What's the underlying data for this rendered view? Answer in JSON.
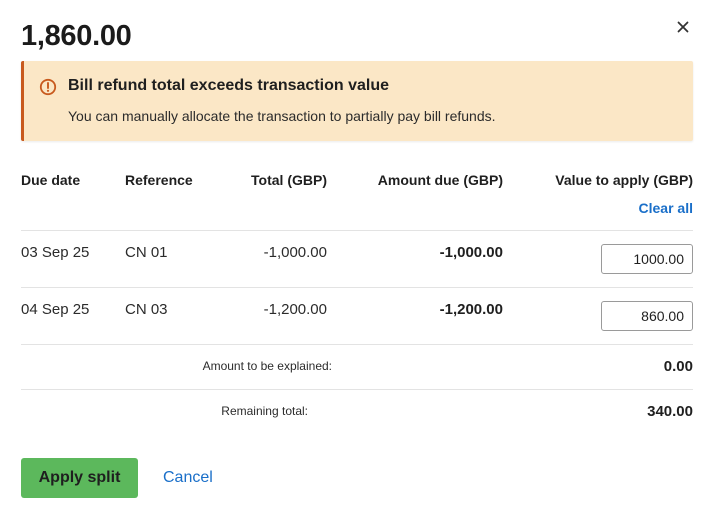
{
  "header": {
    "title": "1,860.00",
    "close_icon": "close-icon"
  },
  "alert": {
    "icon": "warning-circle-icon",
    "title": "Bill refund total exceeds transaction value",
    "body": "You can manually allocate the transaction to partially pay bill refunds.",
    "background": "#fbe7c6",
    "accent": "#c85a1e"
  },
  "table": {
    "headers": {
      "due_date": "Due date",
      "reference": "Reference",
      "total": "Total (GBP)",
      "amount_due": "Amount due (GBP)",
      "value_to_apply": "Value to apply (GBP)"
    },
    "clear_all": "Clear all",
    "rows": [
      {
        "due_date": "03 Sep 25",
        "reference": "CN 01",
        "total": "-1,000.00",
        "amount_due": "-1,000.00",
        "value": "1000.00"
      },
      {
        "due_date": "04 Sep 25",
        "reference": "CN 03",
        "total": "-1,200.00",
        "amount_due": "-1,200.00",
        "value": "860.00"
      }
    ]
  },
  "summary": {
    "explained_label": "Amount to be explained:",
    "explained_value": "0.00",
    "remaining_label": "Remaining total:",
    "remaining_value": "340.00"
  },
  "actions": {
    "apply_label": "Apply split",
    "cancel_label": "Cancel",
    "apply_color": "#5cb85c",
    "link_color": "#1a6fc9"
  }
}
